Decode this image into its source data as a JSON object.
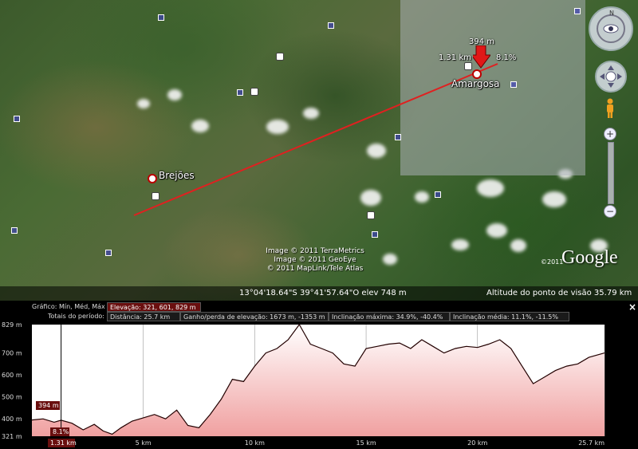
{
  "map": {
    "places": [
      {
        "name": "Brejões"
      },
      {
        "name": "Amargosa"
      }
    ],
    "cursor": {
      "elev": "394 m",
      "dist": "1.31 km",
      "slope": "8.1%"
    },
    "attribution": [
      "Image © 2011 TerraMetrics",
      "Image © 2011 GeoEye",
      "© 2011 MapLink/Tele Atlas"
    ],
    "logo": "Google",
    "logo_copyright": "©2011",
    "status": {
      "coords": "13°04'18.64\"S   39°41'57.64\"O   elev  748 m",
      "eye_alt": "Altitude do ponto de visão    35.79 km"
    },
    "zoom_plus": "+",
    "zoom_minus": "−"
  },
  "panel": {
    "row1_label": "Gráfico: Mín, Méd, Máx",
    "row1_value": "Elevação: 321, 601, 829 m",
    "row2_label": "Totais do período:",
    "distance": "Distância: 25.7 km",
    "gain_loss": "Ganho/perda de elevação: 1673 m, -1353 m",
    "max_slope": "Inclinação máxima: 34.9%, -40.4%",
    "avg_slope": "Inclinação média: 11.1%, -11.5%",
    "close": "×",
    "marker_elev": "394 m",
    "marker_slope": "8.1%",
    "marker_dist": "1.31 km"
  },
  "chart_data": {
    "type": "area",
    "title": "",
    "xlabel": "",
    "ylabel": "",
    "xlim": [
      0,
      25.7
    ],
    "ylim": [
      321,
      829
    ],
    "y_ticks": [
      "829 m",
      "700 m",
      "600 m",
      "500 m",
      "400 m",
      "321 m"
    ],
    "x_ticks": [
      "5 km",
      "10 km",
      "15 km",
      "20 km",
      "25.7 km"
    ],
    "x": [
      0,
      0.5,
      1.0,
      1.31,
      1.8,
      2.3,
      2.8,
      3.2,
      3.6,
      4.0,
      4.5,
      5.0,
      5.5,
      6.0,
      6.5,
      7.0,
      7.5,
      8.0,
      8.5,
      9.0,
      9.5,
      10.0,
      10.5,
      11.0,
      11.5,
      12.0,
      12.5,
      13.0,
      13.5,
      14.0,
      14.5,
      15.0,
      15.5,
      16.0,
      16.5,
      17.0,
      17.5,
      18.0,
      18.5,
      19.0,
      19.5,
      20.0,
      20.5,
      21.0,
      21.5,
      22.0,
      22.5,
      23.0,
      23.5,
      24.0,
      24.5,
      25.0,
      25.7
    ],
    "values": [
      395,
      400,
      385,
      394,
      380,
      350,
      375,
      345,
      330,
      360,
      390,
      405,
      420,
      400,
      440,
      370,
      360,
      420,
      490,
      580,
      570,
      640,
      700,
      720,
      760,
      829,
      740,
      720,
      700,
      650,
      640,
      720,
      730,
      740,
      745,
      720,
      760,
      730,
      700,
      720,
      730,
      725,
      740,
      760,
      720,
      640,
      560,
      590,
      620,
      640,
      650,
      680,
      700
    ]
  }
}
